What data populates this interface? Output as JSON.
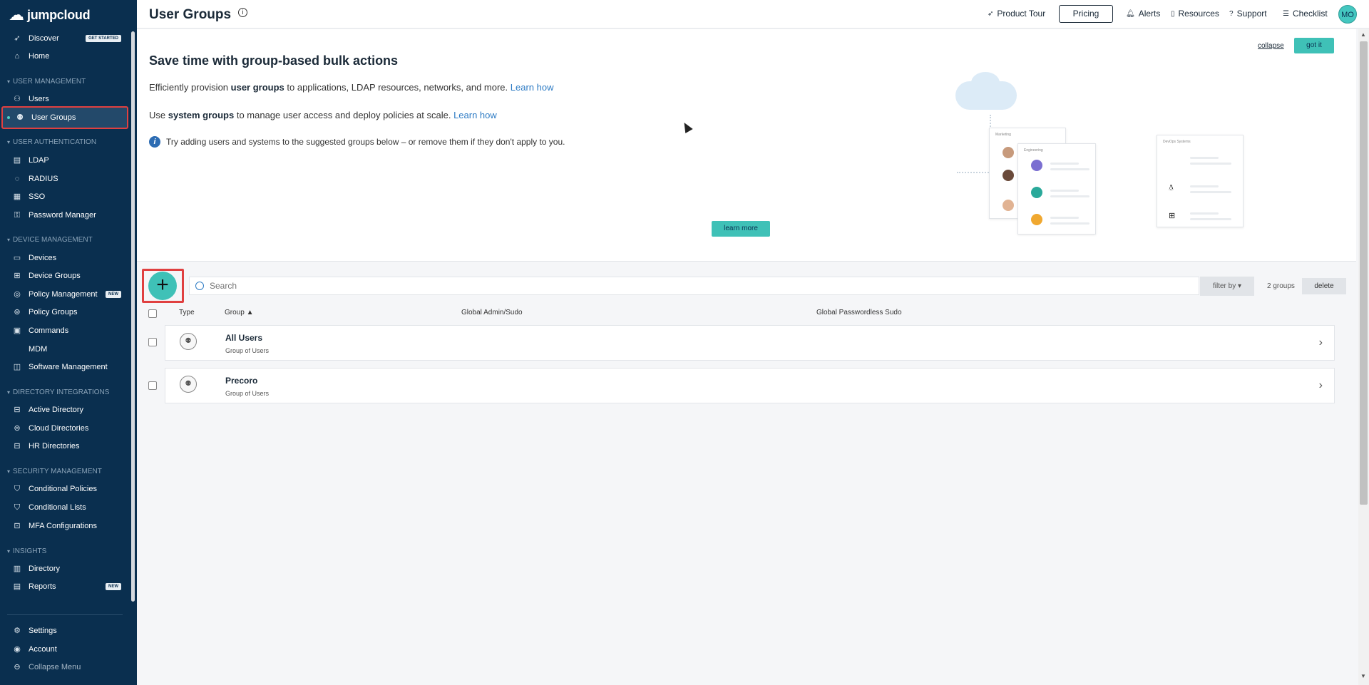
{
  "app": {
    "logo_text": "jumpcloud"
  },
  "sidebar": {
    "items_top": [
      {
        "label": "Discover",
        "badge": "GET STARTED"
      },
      {
        "label": "Home"
      }
    ],
    "sections": [
      {
        "title": "USER MANAGEMENT"
      },
      {
        "title": "USER AUTHENTICATION"
      },
      {
        "title": "DEVICE MANAGEMENT"
      },
      {
        "title": "DIRECTORY INTEGRATIONS"
      },
      {
        "title": "SECURITY MANAGEMENT"
      },
      {
        "title": "INSIGHTS"
      }
    ],
    "items": [
      {
        "label": "Users"
      },
      {
        "label": "User Groups"
      },
      {
        "label": "LDAP"
      },
      {
        "label": "RADIUS"
      },
      {
        "label": "SSO"
      },
      {
        "label": "Password Manager"
      },
      {
        "label": "Devices"
      },
      {
        "label": "Device Groups"
      },
      {
        "label": "Policy Management",
        "badge": "NEW"
      },
      {
        "label": "Policy Groups"
      },
      {
        "label": "Commands"
      },
      {
        "label": "MDM"
      },
      {
        "label": "Software Management"
      },
      {
        "label": "Active Directory"
      },
      {
        "label": "Cloud Directories"
      },
      {
        "label": "HR Directories"
      },
      {
        "label": "Conditional Policies"
      },
      {
        "label": "Conditional Lists"
      },
      {
        "label": "MFA Configurations"
      },
      {
        "label": "Directory"
      },
      {
        "label": "Reports",
        "badge": "NEW"
      }
    ],
    "bottom": [
      {
        "label": "Settings"
      },
      {
        "label": "Account"
      },
      {
        "label": "Collapse Menu"
      }
    ]
  },
  "header": {
    "title": "User Groups",
    "product_tour": "Product Tour",
    "pricing": "Pricing",
    "alerts": "Alerts",
    "resources": "Resources",
    "support": "Support",
    "checklist": "Checklist",
    "avatar": "MO"
  },
  "banner": {
    "title": "Save time with group-based bulk actions",
    "line1_pre": "Efficiently provision ",
    "line1_bold": "user groups",
    "line1_post": " to applications, LDAP resources, networks, and more. ",
    "line1_link": "Learn how",
    "line2_pre": "Use ",
    "line2_bold": "system groups",
    "line2_post": " to manage user access and deploy policies at scale. ",
    "line2_link": "Learn how",
    "tip": "Try adding users and systems to the suggested groups below – or remove them if they don't apply to you.",
    "collapse": "collapse",
    "got_it": "got it",
    "learn_more": "learn more",
    "ill_marketing": "Marketing",
    "ill_engineering": "Engineering",
    "ill_devops": "DevOps Systems"
  },
  "toolbar": {
    "search_placeholder": "Search",
    "filter": "filter by ▾",
    "count": "2 groups",
    "delete": "delete"
  },
  "table": {
    "headers": {
      "type": "Type",
      "group": "Group ▲",
      "admin": "Global Admin/Sudo",
      "passwordless": "Global Passwordless Sudo"
    },
    "rows": [
      {
        "name": "All Users",
        "sub": "Group of Users"
      },
      {
        "name": "Precoro",
        "sub": "Group of Users"
      }
    ]
  }
}
